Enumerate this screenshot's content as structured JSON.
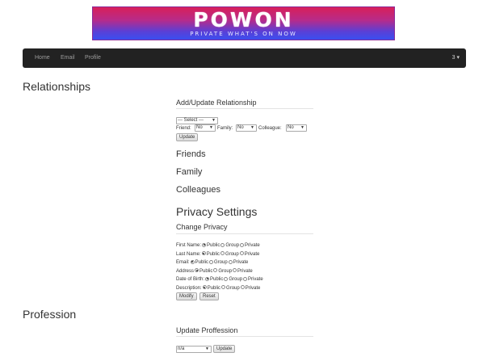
{
  "banner": {
    "logo": "POWON",
    "tagline": "PRIVATE WHAT'S ON NOW"
  },
  "nav": {
    "items": [
      "Home",
      "Email",
      "Profile"
    ],
    "right_label": "3 ▾"
  },
  "relationships": {
    "heading": "Relationships",
    "subheading": "Add/Update Relationship",
    "select_value": "--- Select ---",
    "friend_label": "Friend:",
    "friend_value": "No",
    "family_label": "Family:",
    "family_value": "No",
    "colleague_label": "Colleague:",
    "colleague_value": "No",
    "update_button": "Update",
    "friends": "Friends",
    "family": "Family",
    "colleagues": "Colleagues"
  },
  "privacy": {
    "heading": "Privacy Settings",
    "subheading": "Change Privacy",
    "options": [
      "Public",
      "Group",
      "Private"
    ],
    "rows": [
      {
        "label": "First Name:",
        "selected": 0
      },
      {
        "label": "Last Name:",
        "selected": 0
      },
      {
        "label": "Email:",
        "selected": 0
      },
      {
        "label": "Address",
        "selected": 0
      },
      {
        "label": "Date of Birth:",
        "selected": 0
      },
      {
        "label": "Description:",
        "selected": 0
      }
    ],
    "modify_button": "Modify",
    "reset_button": "Reset"
  },
  "profession": {
    "heading": "Profession",
    "subheading": "Update Proffession",
    "select_value": "n/a",
    "update_button": "Update"
  }
}
